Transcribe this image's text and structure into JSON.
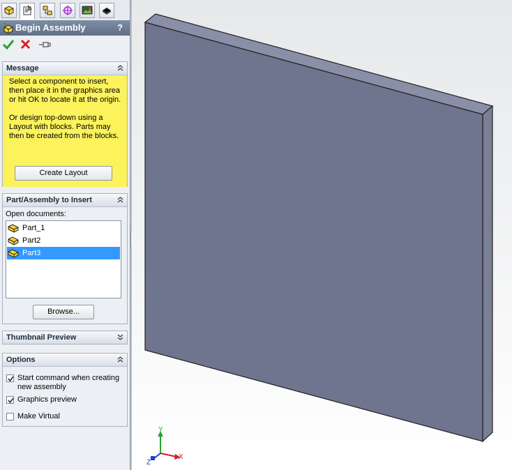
{
  "tabs": [
    {
      "name": "featuremanager-tab",
      "icon": "feature-tree-icon",
      "active": false
    },
    {
      "name": "propertymanager-tab",
      "icon": "property-manager-icon",
      "active": true
    },
    {
      "name": "configurationmanager-tab",
      "icon": "configuration-icon",
      "active": false
    },
    {
      "name": "dimxpert-tab",
      "icon": "dimxpert-icon",
      "active": false
    },
    {
      "name": "display-manager-tab",
      "icon": "display-manager-icon",
      "active": false
    },
    {
      "name": "cam-tab",
      "icon": "cam-icon",
      "active": false
    }
  ],
  "header": {
    "title": "Begin Assembly",
    "help": "?"
  },
  "actions": {
    "ok": "ok-check-icon",
    "cancel": "cancel-x-icon",
    "pin": "pushpin-icon"
  },
  "message": {
    "title": "Message",
    "paragraph1": "Select a component to insert, then place it in the graphics area or hit OK to locate it at the origin.",
    "paragraph2": "Or design top-down using a Layout with blocks. Parts may then be created from the blocks.",
    "create_layout": "Create Layout",
    "background": "#fbf25c"
  },
  "insert": {
    "title": "Part/Assembly to Insert",
    "open_label": "Open documents:",
    "documents": [
      "Part_1",
      "Part2",
      "Part3"
    ],
    "selected_index": 2,
    "browse": "Browse..."
  },
  "thumbnail": {
    "title": "Thumbnail Preview"
  },
  "options": {
    "title": "Options",
    "items": [
      {
        "label": "Start command when creating new assembly",
        "checked": true
      },
      {
        "label": "Graphics preview",
        "checked": true
      },
      {
        "label": "Make Virtual",
        "checked": false
      }
    ]
  },
  "triad": {
    "x": "X",
    "y": "Y",
    "z": "Z"
  },
  "colors": {
    "selection": "#3399ff",
    "part_face": "#6f748f",
    "part_edge": "#222222"
  }
}
